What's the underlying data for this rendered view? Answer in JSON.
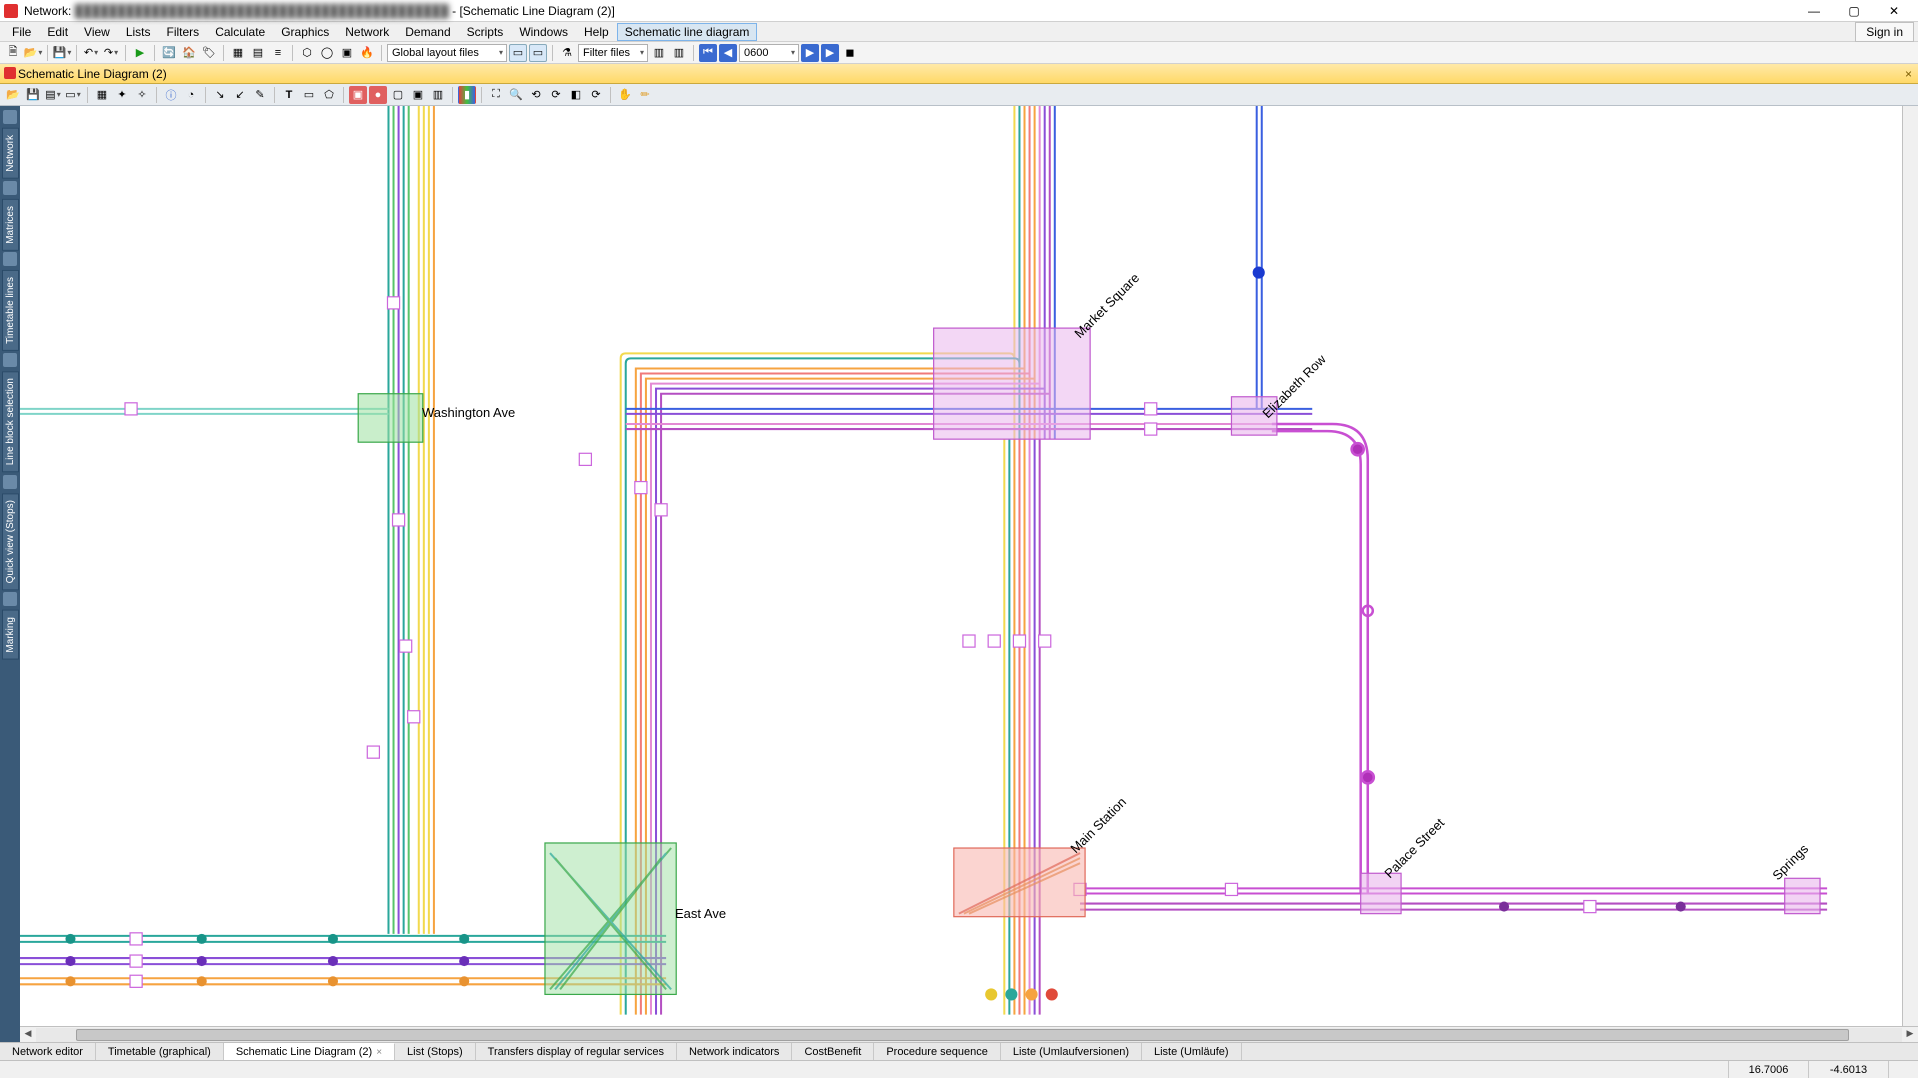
{
  "app": {
    "title_prefix": "Network:",
    "title_redacted": "████████████████████████████████████████████",
    "title_suffix": " - [Schematic Line Diagram (2)]"
  },
  "window_buttons": {
    "min": "—",
    "max": "▢",
    "close": "✕"
  },
  "menu": {
    "items": [
      "File",
      "Edit",
      "View",
      "Lists",
      "Filters",
      "Calculate",
      "Graphics",
      "Network",
      "Demand",
      "Scripts",
      "Windows",
      "Help"
    ],
    "active": "Schematic line diagram",
    "signin": "Sign in"
  },
  "toolbar1": {
    "global_layout_label": "Global layout files",
    "filter_files_label": "Filter files",
    "time_value": "0600"
  },
  "doc_tab": {
    "label": "Schematic Line Diagram (2)"
  },
  "left_tabs": [
    "Network",
    "Matrices",
    "Timetable lines",
    "Line block selection",
    "Quick view (Stops)",
    "Marking"
  ],
  "bottom_tabs": [
    "Network editor",
    "Timetable (graphical)",
    "Schematic Line Diagram (2)",
    "List (Stops)",
    "Transfers display of regular services",
    "Network indicators",
    "CostBenefit",
    "Procedure sequence",
    "Liste (Umlaufversionen)",
    "Liste (Umläufe)"
  ],
  "bottom_active_index": 2,
  "status": {
    "coord_x": "16.7006",
    "coord_y": "-4.6013"
  },
  "stations": {
    "washington": "Washington Ave",
    "market": "Market Square",
    "elizabeth": "Elizabeth Row",
    "main": "Main Station",
    "palace": "Palace Street",
    "springs": "Springs",
    "east": "East Ave"
  },
  "colors": {
    "green": "#57c46a",
    "teal": "#2aa79b",
    "yellow": "#f2d94e",
    "orange": "#f6a340",
    "red": "#f07a7a",
    "purple": "#b44fc2",
    "violet": "#8a4fd8",
    "blue": "#3a5fe0",
    "pink": "#e48ad4",
    "magenta_box": "#e9b6ec",
    "green_box": "#9de0a1",
    "red_box": "#f8b8b0",
    "violet_box": "#d9b8f0"
  }
}
